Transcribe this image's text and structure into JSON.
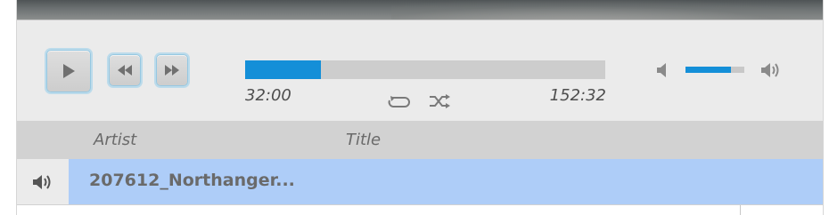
{
  "player": {
    "progress_fraction": 0.21,
    "time_elapsed": "32:00",
    "time_total": "152:32",
    "volume_fraction": 0.78,
    "accent_color": "#148fd8",
    "controls": {
      "play_icon": "play-icon",
      "prev_icon": "rewind-icon",
      "next_icon": "fast-forward-icon",
      "repeat_icon": "repeat-icon",
      "shuffle_icon": "shuffle-icon",
      "volume_low_icon": "volume-low-icon",
      "volume_high_icon": "volume-high-icon"
    }
  },
  "playlist": {
    "columns": [
      "Artist",
      "Title"
    ],
    "rows": [
      {
        "artist": "207612_Northanger...",
        "title": "",
        "playing": true
      }
    ],
    "selected_color": "#aecdf8"
  }
}
